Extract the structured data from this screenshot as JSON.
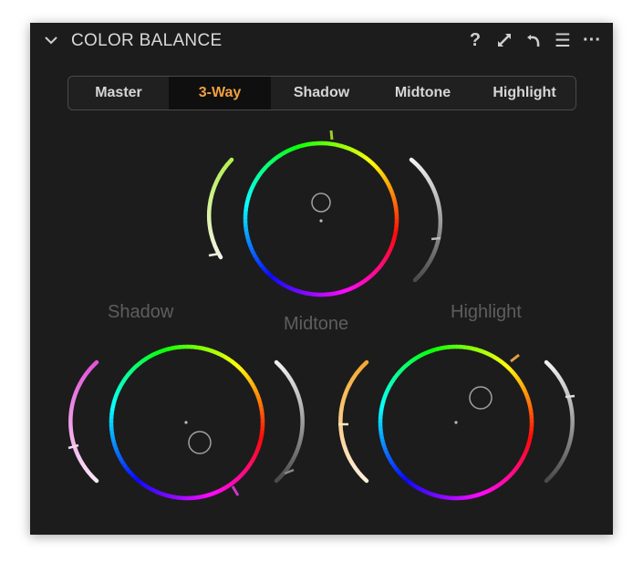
{
  "panel": {
    "title": "COLOR BALANCE",
    "header_icons": [
      "help-icon",
      "expand-icon",
      "reset-icon",
      "menu-icon",
      "more-icon"
    ],
    "help_glyph": "?",
    "menu_glyph": "☰",
    "more_glyph": "···"
  },
  "tabs": [
    {
      "label": "Master",
      "active": false
    },
    {
      "label": "3-Way",
      "active": true
    },
    {
      "label": "Shadow",
      "active": false
    },
    {
      "label": "Midtone",
      "active": false
    },
    {
      "label": "Highlight",
      "active": false
    }
  ],
  "wheels": {
    "midtone": {
      "label": "Midtone"
    },
    "shadow": {
      "label": "Shadow"
    },
    "highlight": {
      "label": "Highlight"
    }
  },
  "colors": {
    "panel_bg": "#1c1c1c",
    "active_tab_text": "#f0a040",
    "label_gray": "#5e5e5e"
  }
}
